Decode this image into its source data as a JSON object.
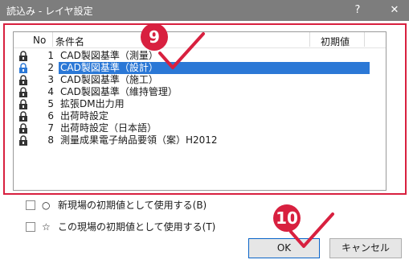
{
  "window": {
    "title": "読込み - レイヤ設定",
    "help_label": "?",
    "close_label": "✕"
  },
  "list": {
    "columns": [
      "No",
      "条件名",
      "初期値"
    ],
    "rows": [
      {
        "no": "1",
        "name": "CAD製図基準（測量）",
        "selected": false
      },
      {
        "no": "2",
        "name": "CAD製図基準（設計）",
        "selected": true
      },
      {
        "no": "3",
        "name": "CAD製図基準（施工）",
        "selected": false
      },
      {
        "no": "4",
        "name": "CAD製図基準（維持管理）",
        "selected": false
      },
      {
        "no": "5",
        "name": "拡張DM出力用",
        "selected": false
      },
      {
        "no": "6",
        "name": "出荷時設定",
        "selected": false
      },
      {
        "no": "7",
        "name": "出荷時設定（日本語）",
        "selected": false
      },
      {
        "no": "8",
        "name": "測量成果電子納品要領（案）H2012",
        "selected": false
      }
    ]
  },
  "options": [
    {
      "symbol": "○",
      "label": "新現場の初期値として使用する(B)"
    },
    {
      "symbol": "☆",
      "label": "この現場の初期値として使用する(T)"
    }
  ],
  "buttons": {
    "ok_label": "OK",
    "cancel_label": "キャンセル"
  },
  "annotations": {
    "marker_9": "9",
    "marker_10": "10",
    "accent_color": "#d8203f"
  }
}
